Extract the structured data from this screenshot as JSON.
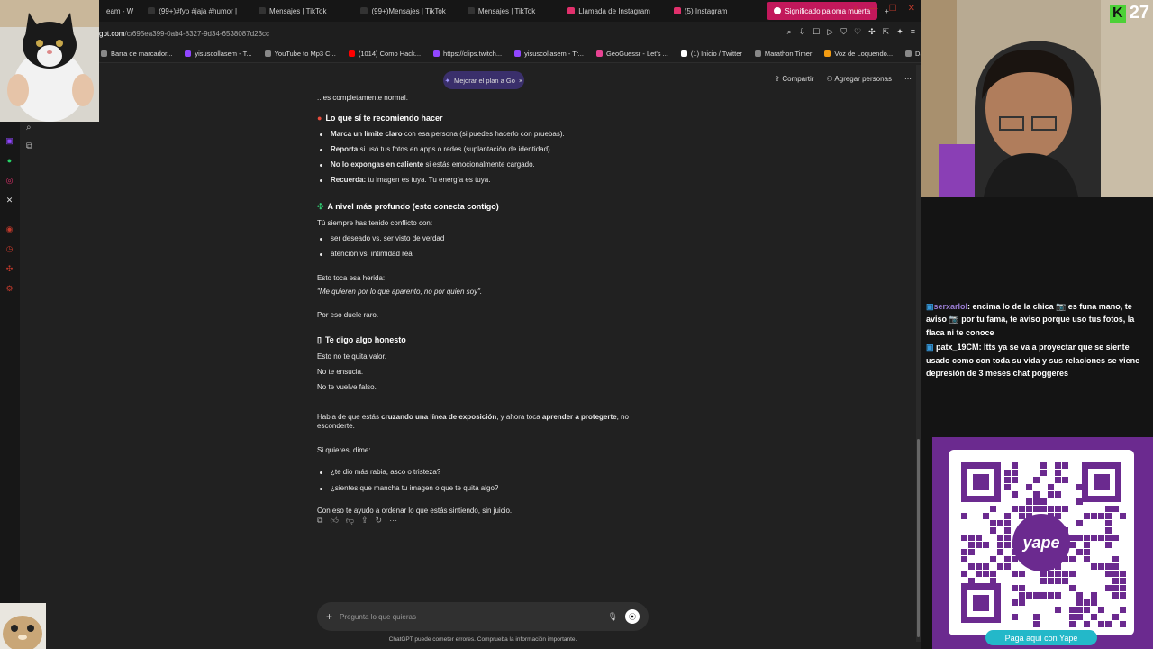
{
  "tabs": [
    {
      "label": "eam - W"
    },
    {
      "label": "(99+)#fyp #jaja #humor |"
    },
    {
      "label": "Mensajes | TikTok"
    },
    {
      "label": "(99+)Mensajes | TikTok"
    },
    {
      "label": "Mensajes | TikTok"
    },
    {
      "label": "Llamada de Instagram"
    },
    {
      "label": "(5) Instagram"
    },
    {
      "label": "Significado paloma muerta",
      "active": true
    }
  ],
  "url": {
    "prefix": "gpt.com",
    "path": "/c/695ea399-0ab4-8327-9d34-6538087d23cc"
  },
  "bookmarks": [
    {
      "label": "Barra de marcador...",
      "color": "#888"
    },
    {
      "label": "yisuscollasem - T...",
      "color": "#9146ff"
    },
    {
      "label": "YouTube to Mp3 C...",
      "color": "#888"
    },
    {
      "label": "(1014) Como Hack...",
      "color": "#ff0000"
    },
    {
      "label": "https://clips.twitch...",
      "color": "#9146ff"
    },
    {
      "label": "yisuscollasem - Tr...",
      "color": "#9146ff"
    },
    {
      "label": "GeoGuessr - Let's ...",
      "color": "#e84393"
    },
    {
      "label": "(1) Inicio / Twitter",
      "color": "#ffffff"
    },
    {
      "label": "Marathon Timer",
      "color": "#888"
    },
    {
      "label": "Voz de Loquendo...",
      "color": "#f39c12"
    },
    {
      "label": "Dandadan, Capítul...",
      "color": "#888"
    }
  ],
  "header": {
    "plan_pill": "Mejorar el plan a Go",
    "share": "Compartir",
    "add_people": "Agregar personas"
  },
  "message": {
    "intro": "...es completamente normal.",
    "section1_title": "Lo que sí te recomiendo hacer",
    "section1_items": [
      {
        "bold": "Marca un límite claro",
        "rest": " con esa persona (si puedes hacerlo con pruebas)."
      },
      {
        "bold": "Reporta",
        "rest": " si usó tus fotos en apps o redes (suplantación de identidad)."
      },
      {
        "bold": "No lo expongas en caliente",
        "rest": " si estás emocionalmente cargado."
      },
      {
        "bold": "Recuerda:",
        "rest": " tu imagen es tuya. Tu energía es tuya."
      }
    ],
    "section2_title": "A nivel más profundo (esto conecta contigo)",
    "section2_intro": "Tú siempre has tenido conflicto con:",
    "section2_items": [
      "ser deseado vs. ser visto de verdad",
      "atención vs. intimidad real"
    ],
    "wound_line": "Esto toca esa herida:",
    "wound_quote": "\"Me quieren por lo que aparento, no por quien soy\".",
    "raro": "Por eso duele raro.",
    "section3_title": "Te digo algo honesto",
    "honest_lines": [
      "Esto no te quita valor.",
      "No te ensucia.",
      "No te vuelve falso."
    ],
    "exposure_pre": "Habla de que estás ",
    "exposure_b1": "cruzando una línea de exposición",
    "exposure_mid": ", y ahora toca ",
    "exposure_b2": "aprender a protegerte",
    "exposure_post": ", no esconderte.",
    "ask": "Si quieres, dime:",
    "questions": [
      "¿te dio más rabia, asco o tristeza?",
      "¿sientes que mancha tu imagen o que te quita algo?"
    ],
    "closing": "Con eso te ayudo a ordenar lo que estás sintiendo, sin juicio."
  },
  "input": {
    "placeholder": "Pregunta lo que quieras"
  },
  "disclaimer": "ChatGPT puede cometer errores. Comprueba la información importante.",
  "stream": {
    "counter": "27",
    "chat": [
      {
        "user": "serxarlol",
        "text": ": encima lo de la chica 📷 es funa mano, te aviso 📷 por tu fama, te aviso porque uso tus fotos, la flaca ni te conoce"
      },
      {
        "user": "patx_19CM",
        "text": ": ltts ya se va a proyectar que se siente usado como con toda su vida y sus relaciones se viene depresión de 3 meses chat poggeres"
      }
    ],
    "qr_label": "Paga aquí con Yape",
    "qr_brand": "yape"
  }
}
